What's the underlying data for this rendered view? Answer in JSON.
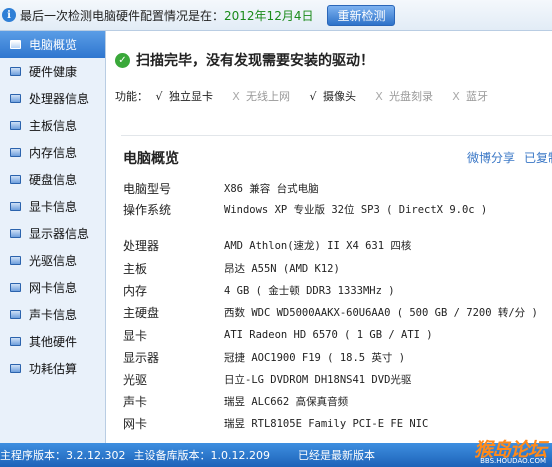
{
  "topbar": {
    "last_check_label": "最后一次检测电脑硬件配置情况是在：",
    "last_check_date": "2012年12月4日",
    "recheck_button": "重新检测"
  },
  "sidebar": {
    "items": [
      {
        "label": "电脑概览",
        "active": true
      },
      {
        "label": "硬件健康"
      },
      {
        "label": "处理器信息"
      },
      {
        "label": "主板信息"
      },
      {
        "label": "内存信息"
      },
      {
        "label": "硬盘信息"
      },
      {
        "label": "显卡信息"
      },
      {
        "label": "显示器信息"
      },
      {
        "label": "光驱信息"
      },
      {
        "label": "网卡信息"
      },
      {
        "label": "声卡信息"
      },
      {
        "label": "其他硬件"
      },
      {
        "label": "功耗估算"
      }
    ]
  },
  "main": {
    "scan_message": "扫描完毕，没有发现需要安装的驱动！",
    "functions_label": "功能：",
    "features": [
      {
        "mark": "√",
        "name": "独立显卡",
        "available": true
      },
      {
        "mark": "X",
        "name": "无线上网",
        "available": false
      },
      {
        "mark": "√",
        "name": "摄像头",
        "available": true
      },
      {
        "mark": "X",
        "name": "光盘刻录",
        "available": false
      },
      {
        "mark": "X",
        "name": "蓝牙",
        "available": false
      }
    ],
    "section_title": "电脑概览",
    "share_weibo": "微博分享",
    "share_copy": "已复制",
    "specs": [
      {
        "label": "电脑型号",
        "value": "X86 兼容 台式电脑"
      },
      {
        "label": "操作系统",
        "value": "Windows XP 专业版 32位 SP3 ( DirectX 9.0c )"
      },
      {
        "label": "处理器",
        "value": "AMD Athlon(速龙) II X4 631 四核"
      },
      {
        "label": "主板",
        "value": "昂达 A55N (AMD K12)"
      },
      {
        "label": "内存",
        "value": "4 GB ( 金士顿 DDR3 1333MHz )"
      },
      {
        "label": "主硬盘",
        "value": "西数 WDC WD5000AAKX-60U6AA0 ( 500 GB / 7200 转/分 )"
      },
      {
        "label": "显卡",
        "value": "ATI Radeon HD 6570  ( 1 GB / ATI )"
      },
      {
        "label": "显示器",
        "value": "冠捷 AOC1900 F19 ( 18.5 英寸 )"
      },
      {
        "label": "光驱",
        "value": "日立-LG DVDROM DH18NS41 DVD光驱"
      },
      {
        "label": "声卡",
        "value": "瑞昱 ALC662 高保真音频"
      },
      {
        "label": "网卡",
        "value": "瑞昱 RTL8105E Family PCI-E FE NIC"
      }
    ]
  },
  "statusbar": {
    "program_version": "主程序版本：3.2.12.302",
    "db_version": "主设备库版本：1.0.12.209",
    "latest_status": "已经是最新版本"
  },
  "watermark": {
    "main": "猴岛论坛",
    "sub": "BBS.HOUDAO.COM"
  },
  "colors": {
    "accent": "#2f76cf",
    "date_green": "#1a8a1a",
    "watermark_orange": "#ff8a1a"
  }
}
